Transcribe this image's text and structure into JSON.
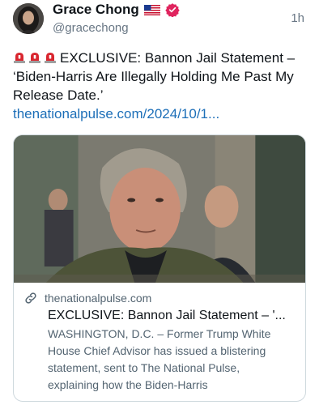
{
  "author": {
    "display_name": "Grace Chong",
    "handle": "@gracechong",
    "flag_icon": "us-flag-icon",
    "verified_icon": "verified-badge-icon",
    "verified_color": "#e0245e"
  },
  "timestamp": "1h",
  "post": {
    "emoji_icon": "siren-icon",
    "emoji_count": 3,
    "text": "EXCLUSIVE: Bannon Jail Statement – ‘Biden-Harris Are Illegally Holding Me Past My Release Date.’",
    "link": "thenationalpulse.com/2024/10/1..."
  },
  "card": {
    "domain": "thenationalpulse.com",
    "title": "EXCLUSIVE: Bannon Jail Statement – '...",
    "description": "WASHINGTON, D.C. – Former Trump White House Chief Advisor has issued a blistering statement, sent to The National Pulse, explaining how the Biden-Harris",
    "link_icon": "link-icon"
  },
  "colors": {
    "link": "#1d6fb8",
    "muted": "#687684",
    "border": "#cfd9de"
  }
}
